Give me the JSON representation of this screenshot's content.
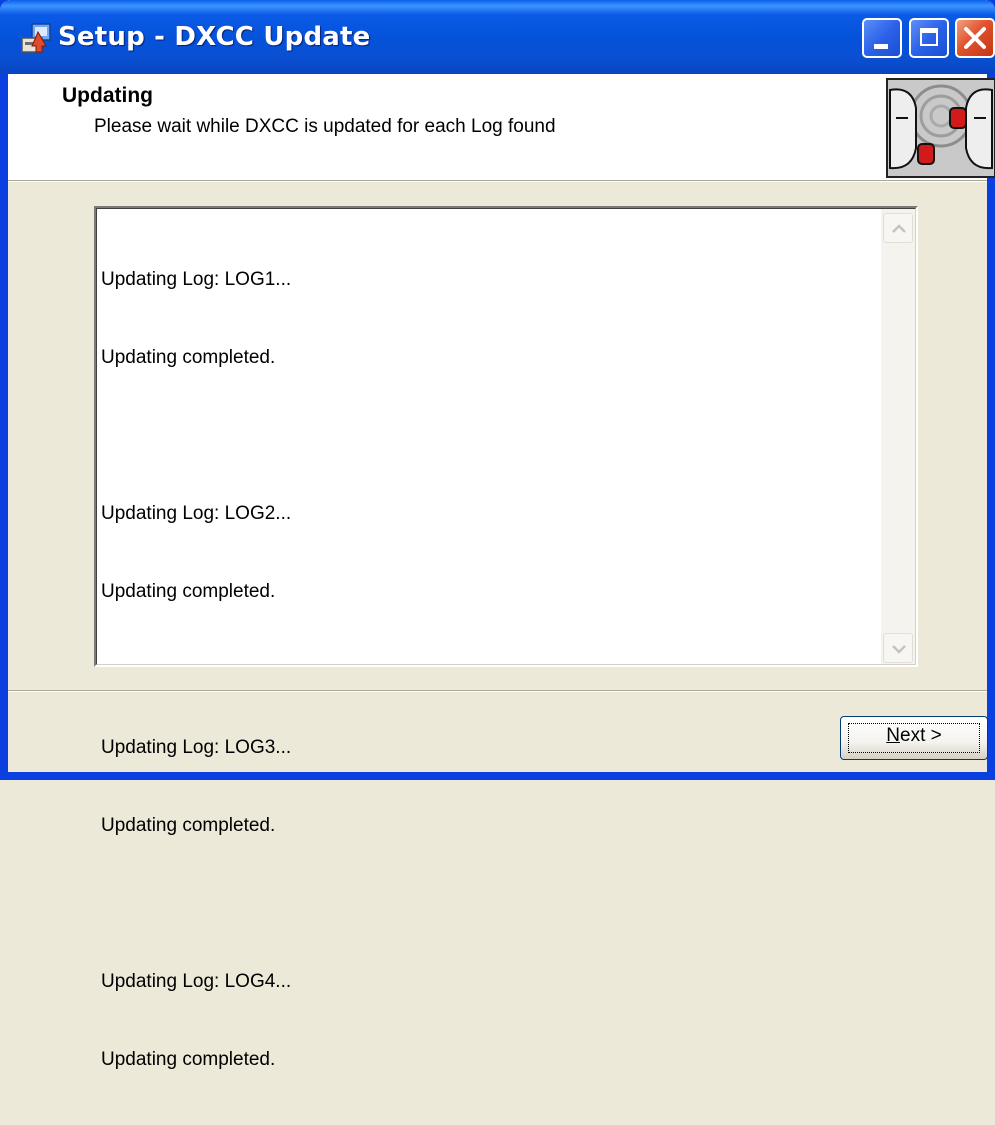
{
  "window": {
    "title": "Setup - DXCC Update",
    "icon": "setup-installer-icon",
    "controls": [
      "minimize-icon",
      "maximize-icon",
      "close-icon"
    ]
  },
  "header": {
    "title": "Updating",
    "subtitle": "Please wait while DXCC is updated for each Log found",
    "image": "wizard-faces-image"
  },
  "log": {
    "lines": [
      "Updating Log: LOG1...",
      "Updating completed.",
      "",
      "Updating Log: LOG2...",
      "Updating completed.",
      "",
      "Updating Log: LOG3...",
      "Updating completed.",
      "",
      "Updating Log: LOG4...",
      "Updating completed."
    ]
  },
  "buttons": {
    "next_mnemonic": "N",
    "next_rest": "ext >"
  },
  "colors": {
    "titlebar": "#0552d9",
    "close": "#e0532e",
    "dialog_bg": "#ece9d8"
  }
}
